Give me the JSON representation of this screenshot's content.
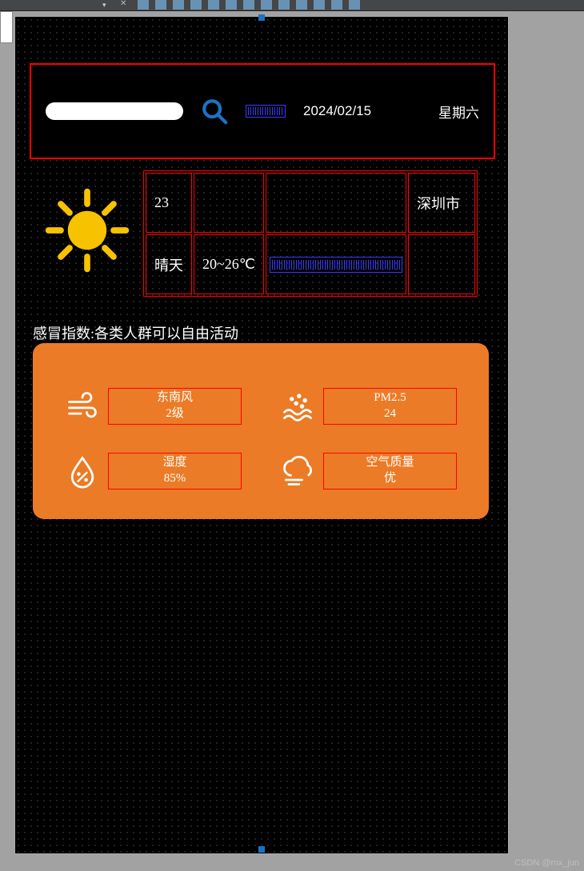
{
  "header": {
    "date": "2024/02/15",
    "weekday": "星期六"
  },
  "weather": {
    "temperature": "23",
    "condition": "晴天",
    "temp_range": "20~26℃",
    "city": "深圳市"
  },
  "cold_index": "感冒指数:各类人群可以自由活动",
  "metrics": {
    "wind": {
      "label": "东南风",
      "value": "2级"
    },
    "pm25": {
      "label": "PM2.5",
      "value": "24"
    },
    "humidity": {
      "label": "湿度",
      "value": "85%"
    },
    "air_quality": {
      "label": "空气质量",
      "value": "优"
    }
  },
  "watermark": "CSDN @mx_jun"
}
